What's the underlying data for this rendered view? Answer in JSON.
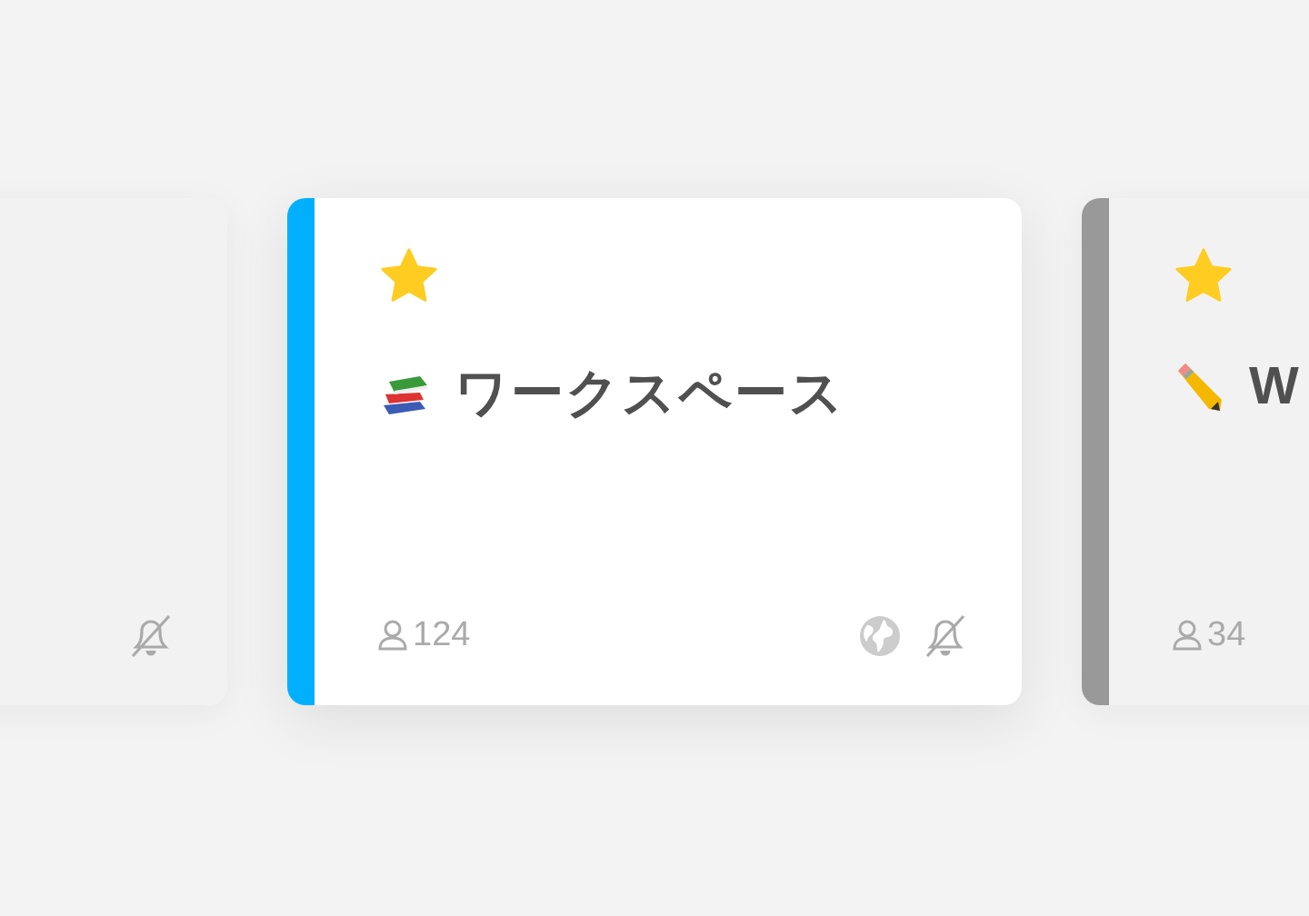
{
  "cards": [
    {
      "selected": false,
      "muted": true
    },
    {
      "selected": true,
      "color": "#00b0ff",
      "starred": true,
      "kind": "books",
      "title": "ワークスペース",
      "members": "124",
      "public": true,
      "muted": true
    },
    {
      "selected": false,
      "color": "#999999",
      "starred": true,
      "kind": "pencil",
      "title": "W",
      "members": "34"
    }
  ]
}
